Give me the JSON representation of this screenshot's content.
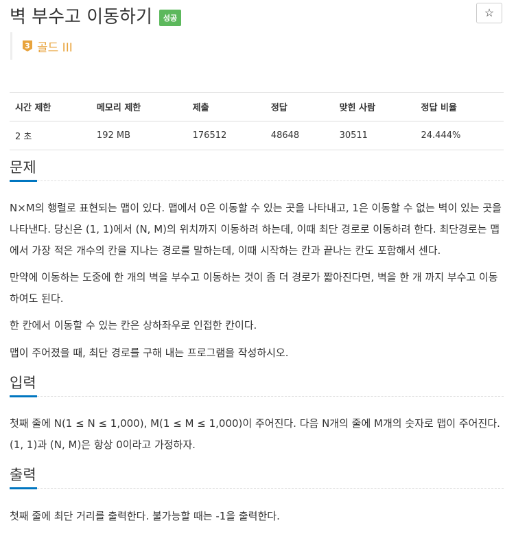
{
  "problem": {
    "title": "벽 부수고 이동하기",
    "result_badge": "성공",
    "star": "☆",
    "tier_number": "3",
    "tier_label": "골드 III",
    "tier_color": "#e8a33c"
  },
  "stats": {
    "headers": [
      "시간 제한",
      "메모리 제한",
      "제출",
      "정답",
      "맞힌 사람",
      "정답 비율"
    ],
    "values": [
      "2 초",
      "192 MB",
      "176512",
      "48648",
      "30511",
      "24.444%"
    ]
  },
  "sections": {
    "description": {
      "heading": "문제",
      "paragraphs": [
        "N×M의 행렬로 표현되는 맵이 있다. 맵에서 0은 이동할 수 있는 곳을 나타내고, 1은 이동할 수 없는 벽이 있는 곳을 나타낸다. 당신은 (1, 1)에서 (N, M)의 위치까지 이동하려 하는데, 이때 최단 경로로 이동하려 한다. 최단경로는 맵에서 가장 적은 개수의 칸을 지나는 경로를 말하는데, 이때 시작하는 칸과 끝나는 칸도 포함해서 센다.",
        "만약에 이동하는 도중에 한 개의 벽을 부수고 이동하는 것이 좀 더 경로가 짧아진다면, 벽을 한 개 까지 부수고 이동하여도 된다.",
        "한 칸에서 이동할 수 있는 칸은 상하좌우로 인접한 칸이다.",
        "맵이 주어졌을 때, 최단 경로를 구해 내는 프로그램을 작성하시오."
      ]
    },
    "input": {
      "heading": "입력",
      "paragraphs": [
        "첫째 줄에 N(1 ≤ N ≤ 1,000), M(1 ≤ M ≤ 1,000)이 주어진다. 다음 N개의 줄에 M개의 숫자로 맵이 주어진다. (1, 1)과 (N, M)은 항상 0이라고 가정하자."
      ]
    },
    "output": {
      "heading": "출력",
      "paragraphs": [
        "첫째 줄에 최단 거리를 출력한다. 불가능할 때는 -1을 출력한다."
      ]
    }
  },
  "colors": {
    "success": "#5cb85c",
    "accent": "#0076c0",
    "gold": "#e8a33c"
  }
}
